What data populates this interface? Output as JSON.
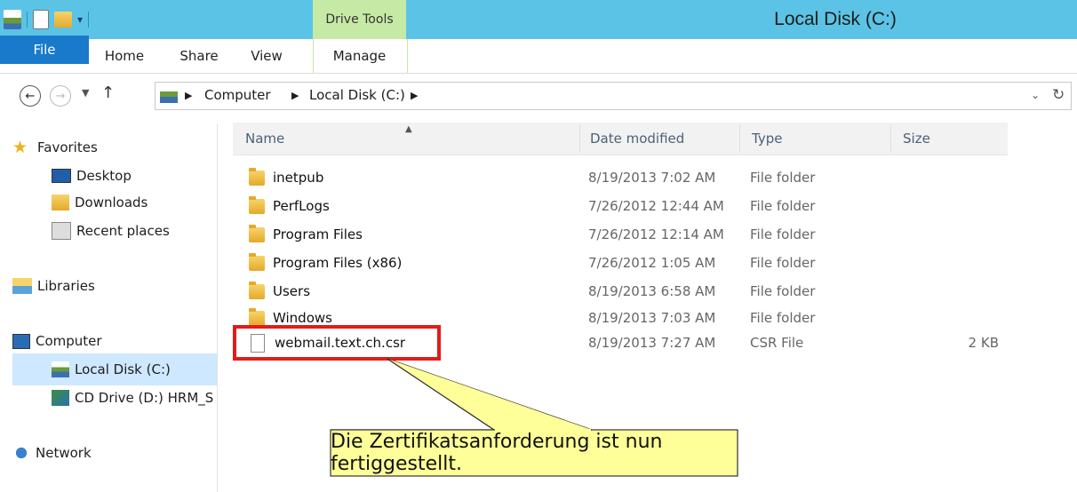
{
  "titlebar": {
    "contextual_tab": "Drive Tools",
    "title": "Local Disk (C:)",
    "bg_color": "#5bc3e6",
    "contextual_color": "#c7e9a6"
  },
  "ribbon": {
    "tabs": [
      "File",
      "Home",
      "Share",
      "View",
      "Manage"
    ],
    "file_color": "#1979ca"
  },
  "address": {
    "back_icon": "back-arrow-icon",
    "forward_icon": "forward-arrow-icon",
    "crumbs": [
      "Computer",
      "Local Disk (C:)"
    ],
    "refresh_icon": "refresh-icon"
  },
  "nav": {
    "favorites": "Favorites",
    "desktop": "Desktop",
    "downloads": "Downloads",
    "recent": "Recent places",
    "libraries": "Libraries",
    "computer": "Computer",
    "local_disk": "Local Disk (C:)",
    "cd_drive": "CD Drive (D:) HRM_S",
    "network": "Network"
  },
  "columns": {
    "name": "Name",
    "date": "Date modified",
    "type": "Type",
    "size": "Size"
  },
  "files": [
    {
      "name": "inetpub",
      "date": "8/19/2013 7:02 AM",
      "type": "File folder",
      "size": ""
    },
    {
      "name": "PerfLogs",
      "date": "7/26/2012 12:44 AM",
      "type": "File folder",
      "size": ""
    },
    {
      "name": "Program Files",
      "date": "7/26/2012 12:14 AM",
      "type": "File folder",
      "size": ""
    },
    {
      "name": "Program Files (x86)",
      "date": "7/26/2012 1:05 AM",
      "type": "File folder",
      "size": ""
    },
    {
      "name": "Users",
      "date": "8/19/2013 6:58 AM",
      "type": "File folder",
      "size": ""
    },
    {
      "name": "Windows",
      "date": "8/19/2013 7:03 AM",
      "type": "File folder",
      "size": ""
    },
    {
      "name": "webmail.text.ch.csr",
      "date": "8/19/2013 7:27 AM",
      "type": "CSR File",
      "size": "2 KB"
    }
  ],
  "callout": {
    "text": "Die Zertifikatsanforderung ist nun fertiggestellt.",
    "fill": "#ffff99",
    "highlight_color": "#e31b1b"
  }
}
